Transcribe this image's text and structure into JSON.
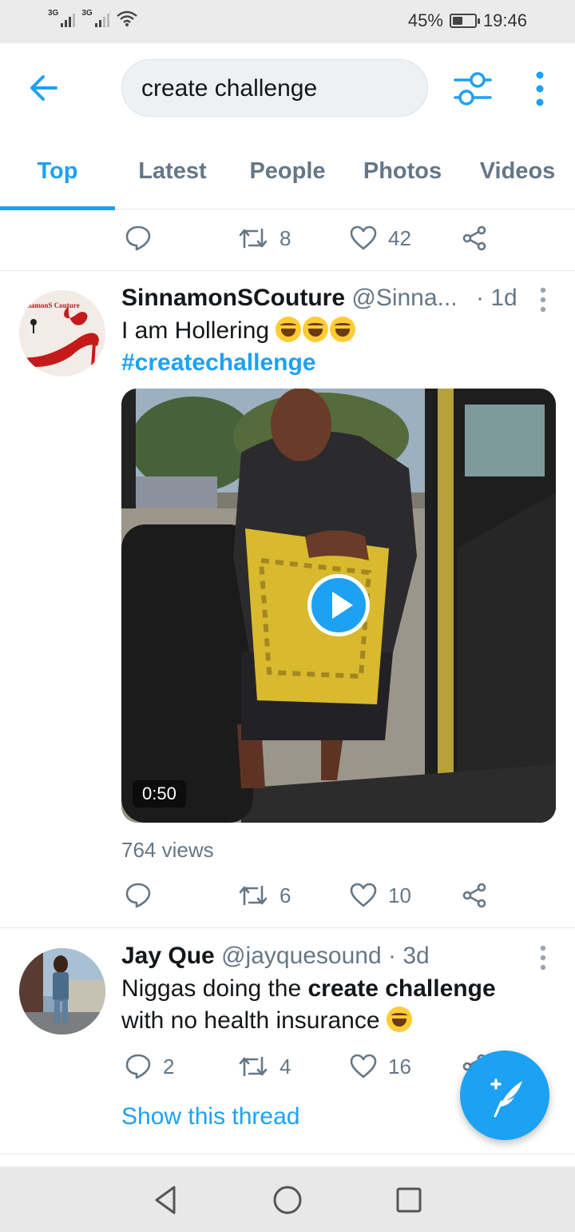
{
  "status_bar": {
    "signal_1": "3G",
    "signal_2": "3G",
    "battery_percent": "45%",
    "battery_level": 0.45,
    "time": "19:46"
  },
  "header": {
    "back_icon": "arrow-left-icon",
    "search_value": "create challenge",
    "filter_icon": "sliders-icon",
    "more_icon": "vertical-dots-icon"
  },
  "tabs": [
    {
      "label": "Top",
      "active": true
    },
    {
      "label": "Latest",
      "active": false
    },
    {
      "label": "People",
      "active": false
    },
    {
      "label": "Photos",
      "active": false
    },
    {
      "label": "Videos",
      "active": false
    }
  ],
  "previous_tweet_actions": {
    "replies": "",
    "retweets": "8",
    "likes": "42"
  },
  "tweets": [
    {
      "name": "SinnamonSCouture",
      "handle": "@Sinna...",
      "time": "· 1d",
      "text": "I am Hollering",
      "hashtag": "#createchallenge",
      "video_duration": "0:50",
      "views": "764 views",
      "replies": "",
      "retweets": "6",
      "likes": "10",
      "avatar_text": "namonS Couture"
    },
    {
      "name": "Jay Que",
      "handle": "@jayquesound",
      "time": "· 3d",
      "text_before": "Niggas doing the ",
      "text_bold": "create challenge",
      "text_after": "with no health insurance",
      "replies": "2",
      "retweets": "4",
      "likes": "16",
      "show_thread": "Show this thread"
    }
  ],
  "fab": {
    "icon": "compose-tweet-icon"
  },
  "colors": {
    "accent": "#1da1f2",
    "secondary_text": "#657786",
    "divider": "#e1e8ed"
  }
}
